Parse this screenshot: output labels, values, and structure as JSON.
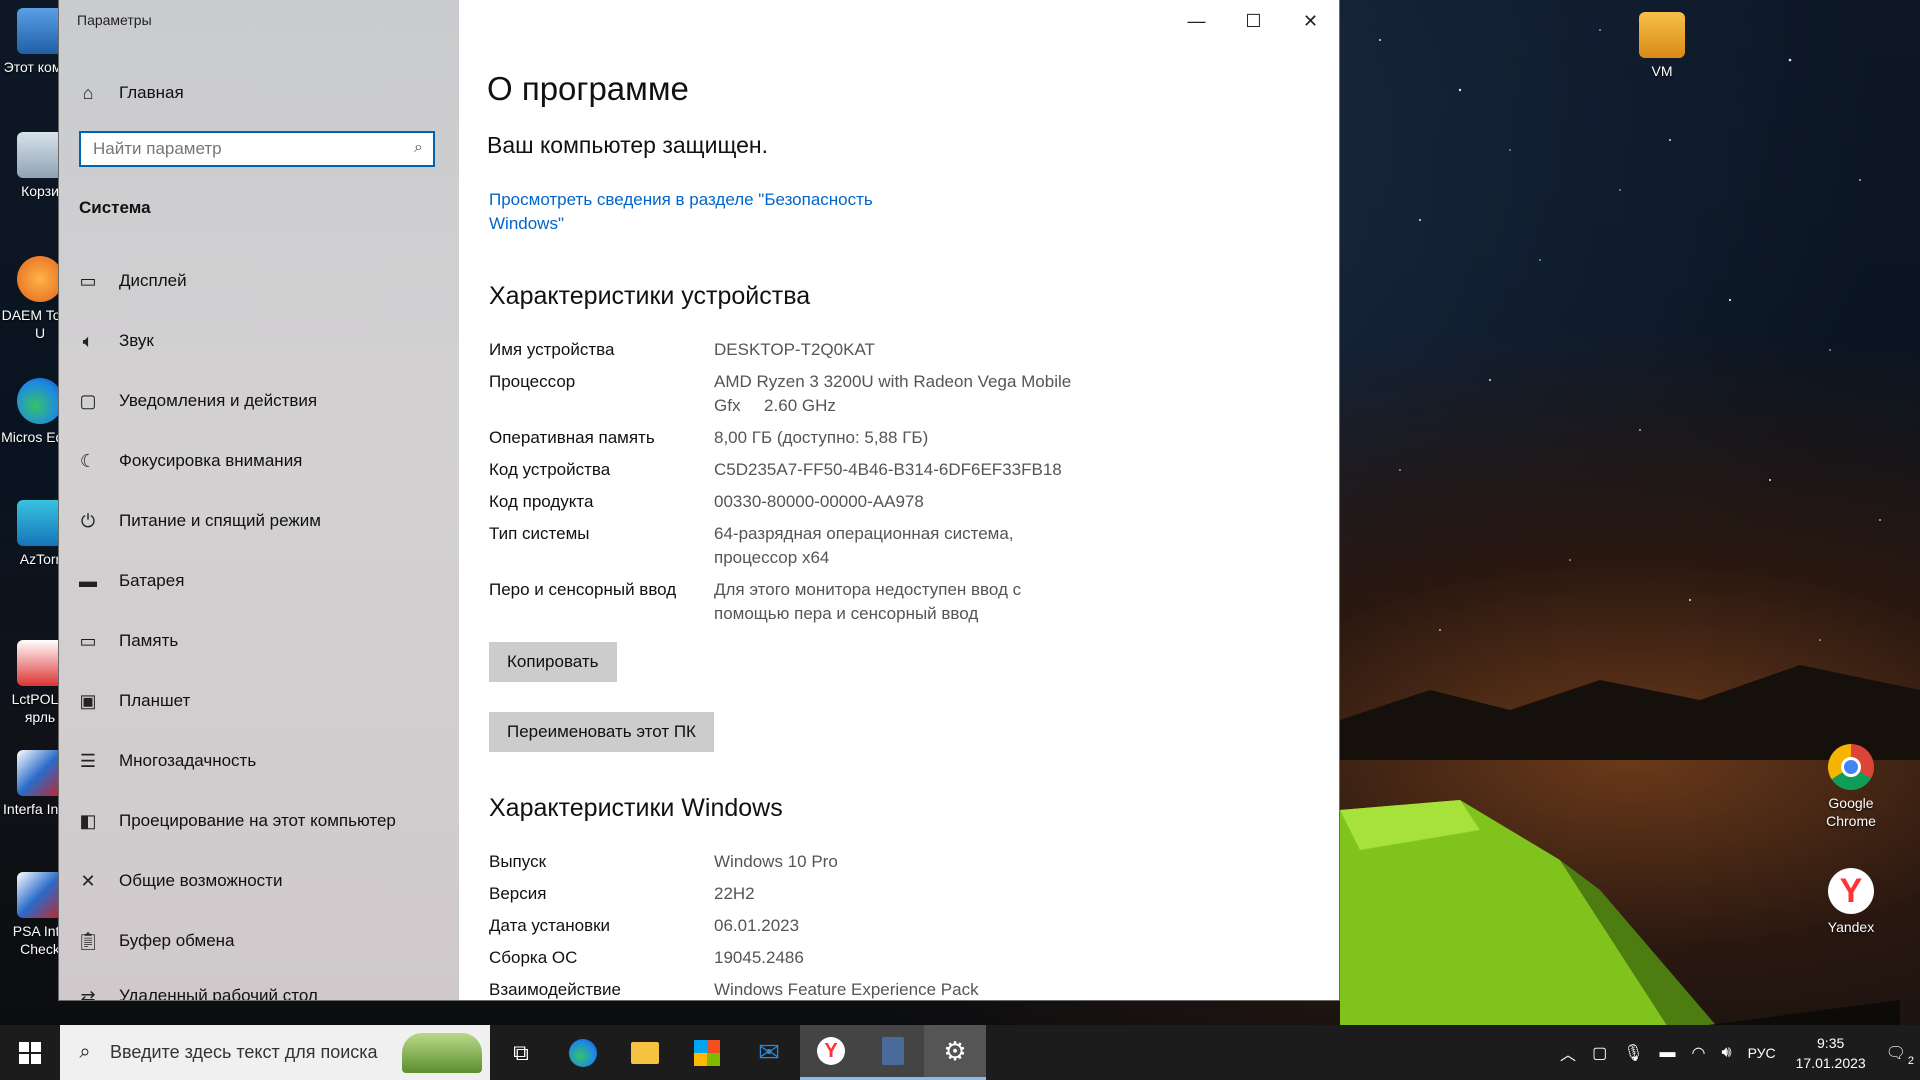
{
  "desktop": {
    "left_icons": [
      {
        "label": "Этот компь",
        "icon": "computer-icon"
      },
      {
        "label": "Корзи",
        "icon": "recycle-bin-icon"
      },
      {
        "label": "DAEM Tools U",
        "icon": "daemon-tools-icon"
      },
      {
        "label": "Micros Edge",
        "icon": "edge-icon"
      },
      {
        "label": "AzTorr",
        "icon": "aztorrent-icon"
      },
      {
        "label": "LctPOLU ярль",
        "icon": "lctpolu-icon"
      },
      {
        "label": "Interfa Insta",
        "icon": "interface-installer-icon"
      },
      {
        "label": "PSA Inte Check",
        "icon": "psa-interface-checker-icon"
      }
    ],
    "right_icons": [
      {
        "label": "VM",
        "icon": "folder-icon"
      },
      {
        "label": "Google Chrome",
        "icon": "chrome-icon"
      },
      {
        "label": "Yandex",
        "icon": "yandex-icon"
      }
    ]
  },
  "window": {
    "title": "Параметры",
    "sidebar": {
      "home": "Главная",
      "search_placeholder": "Найти параметр",
      "section": "Система",
      "items": [
        {
          "label": "Дисплей",
          "icon": "display-icon"
        },
        {
          "label": "Звук",
          "icon": "sound-icon"
        },
        {
          "label": "Уведомления и действия",
          "icon": "notifications-icon"
        },
        {
          "label": "Фокусировка внимания",
          "icon": "focus-assist-icon"
        },
        {
          "label": "Питание и спящий режим",
          "icon": "power-icon"
        },
        {
          "label": "Батарея",
          "icon": "battery-icon"
        },
        {
          "label": "Память",
          "icon": "storage-icon"
        },
        {
          "label": "Планшет",
          "icon": "tablet-icon"
        },
        {
          "label": "Многозадачность",
          "icon": "multitasking-icon"
        },
        {
          "label": "Проецирование на этот компьютер",
          "icon": "projecting-icon"
        },
        {
          "label": "Общие возможности",
          "icon": "shared-experiences-icon"
        },
        {
          "label": "Буфер обмена",
          "icon": "clipboard-icon"
        },
        {
          "label": "Удаленный рабочий стол",
          "icon": "remote-desktop-icon"
        }
      ]
    },
    "content": {
      "title": "О программе",
      "protected": "Ваш компьютер защищен.",
      "security_link": "Просмотреть сведения в разделе \"Безопасность Windows\"",
      "device_heading": "Характеристики устройства",
      "device_specs": [
        {
          "key": "Имя устройства",
          "value": "DESKTOP-T2Q0KAT"
        },
        {
          "key": "Процессор",
          "value": "AMD Ryzen 3 3200U with Radeon Vega Mobile Gfx     2.60 GHz"
        },
        {
          "key": "Оперативная память",
          "value": "8,00 ГБ (доступно: 5,88 ГБ)"
        },
        {
          "key": "Код устройства",
          "value": "C5D235A7-FF50-4B46-B314-6DF6EF33FB18"
        },
        {
          "key": "Код продукта",
          "value": "00330-80000-00000-AA978"
        },
        {
          "key": "Тип системы",
          "value": "64-разрядная операционная система, процессор x64"
        },
        {
          "key": "Перо и сенсорный ввод",
          "value": "Для этого монитора недоступен ввод с помощью пера и сенсорный ввод"
        }
      ],
      "copy_button": "Копировать",
      "rename_button": "Переименовать этот ПК",
      "windows_heading": "Характеристики Windows",
      "windows_specs": [
        {
          "key": "Выпуск",
          "value": "Windows 10 Pro"
        },
        {
          "key": "Версия",
          "value": "22H2"
        },
        {
          "key": "Дата установки",
          "value": "06.01.2023"
        },
        {
          "key": "Сборка ОС",
          "value": "19045.2486"
        },
        {
          "key": "Взаимодействие",
          "value": "Windows Feature Experience Pack"
        }
      ]
    }
  },
  "taskbar": {
    "search_placeholder": "Введите здесь текст для поиска",
    "language": "РУС",
    "time": "9:35",
    "date": "17.01.2023",
    "notification_count": "2"
  }
}
